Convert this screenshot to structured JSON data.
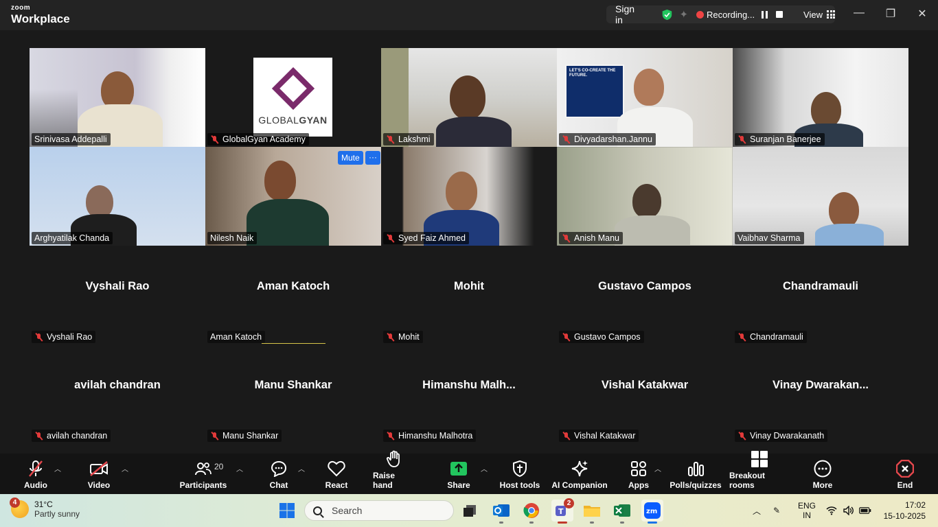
{
  "titlebar": {
    "brand_small": "zoom",
    "brand_big": "Workplace",
    "sign_in": "Sign in",
    "recording": "Recording...",
    "view": "View"
  },
  "window_controls": {
    "minimize": "—",
    "restore": "❐",
    "close": "✕"
  },
  "video_tiles": [
    {
      "name": "Srinivasa Addepalli",
      "muted": false,
      "active": true
    },
    {
      "name": "GlobalGyan Academy",
      "muted": true
    },
    {
      "name": "Lakshmi",
      "muted": true
    },
    {
      "name": "Divyadarshan.Jannu",
      "muted": true
    },
    {
      "name": "Suranjan Banerjee",
      "muted": true
    },
    {
      "name": "Arghyatilak Chanda",
      "muted": false
    },
    {
      "name": "Nilesh Naik",
      "muted": false
    },
    {
      "name": "Syed Faiz Ahmed",
      "muted": true
    },
    {
      "name": "Anish Manu",
      "muted": true
    },
    {
      "name": "Vaibhav Sharma",
      "muted": false
    }
  ],
  "logo": {
    "text_light": "GLOBAL",
    "text_bold": "GYAN"
  },
  "poster_text": "LET'S CO-CREATE THE FUTURE.",
  "hover": {
    "mute": "Mute",
    "more": "···"
  },
  "name_tiles": [
    {
      "big": "Vyshali Rao",
      "label": "Vyshali Rao",
      "muted": true
    },
    {
      "big": "Aman Katoch",
      "label": "Aman Katoch",
      "muted": false
    },
    {
      "big": "Mohit",
      "label": "Mohit",
      "muted": true
    },
    {
      "big": "Gustavo Campos",
      "label": "Gustavo Campos",
      "muted": true
    },
    {
      "big": "Chandramauli",
      "label": "Chandramauli",
      "muted": true
    },
    {
      "big": "avilah chandran",
      "label": "avilah chandran",
      "muted": true
    },
    {
      "big": "Manu Shankar",
      "label": "Manu Shankar",
      "muted": true
    },
    {
      "big": "Himanshu  Malh...",
      "label": "Himanshu Malhotra",
      "muted": true
    },
    {
      "big": "Vishal Katakwar",
      "label": "Vishal Katakwar",
      "muted": true
    },
    {
      "big": "Vinay  Dwarakan...",
      "label": "Vinay Dwarakanath",
      "muted": true
    }
  ],
  "toolbar": {
    "audio": "Audio",
    "video": "Video",
    "participants": "Participants",
    "participants_count": "20",
    "chat": "Chat",
    "react": "React",
    "raise_hand": "Raise hand",
    "share": "Share",
    "host_tools": "Host tools",
    "ai_companion": "AI Companion",
    "apps": "Apps",
    "polls": "Polls/quizzes",
    "breakout": "Breakout rooms",
    "more": "More",
    "end": "End"
  },
  "taskbar": {
    "weather_temp": "31°C",
    "weather_desc": "Partly sunny",
    "weather_badge": "4",
    "search": "Search",
    "teams_badge": "2",
    "lang1": "ENG",
    "lang2": "IN",
    "time": "17:02",
    "date": "15-10-2025"
  },
  "colors": {
    "active_border": "#3ee87c",
    "mute_red": "#e23a3a",
    "share_green": "#22c55e",
    "end_red": "#e5484d",
    "accent_blue": "#1f6feb"
  }
}
